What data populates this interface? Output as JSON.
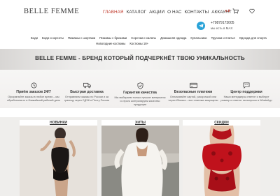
{
  "header": {
    "logo": "BELLE FEMME",
    "nav": [
      "ГЛАВНАЯ",
      "КАТАЛОГ",
      "АКЦИИ",
      "О НАС",
      "КОНТАКТЫ",
      "АККАУНТ"
    ],
    "active_nav": "ГЛАВНАЯ",
    "cart_count": "0 ₽",
    "phone": "+79879173005",
    "messenger": "мы есть в MAX"
  },
  "categories": {
    "row1": [
      "Боди",
      "Боди и корсеты",
      "Пижамы с шортами",
      "Пижамы с брюками",
      "Сорочки и халаты",
      "Домашняя одежда",
      "Купальники",
      "Трусики и платья",
      "Одежда для спорта"
    ],
    "row2": [
      "Новогодние костюмы",
      "Костюмы 18+"
    ]
  },
  "hero": {
    "title": "BELLE FEMME - БРЕНД КОТОРЫЙ ПОДЧЕРКНЁТ ТВОЮ УНИКАЛЬНОСТЬ"
  },
  "features": [
    {
      "icon": "clock-icon",
      "title": "Приём заказов 24/7",
      "desc": "Оформляйте заказы в любое время – мы обработаем их в ближайший рабочий день"
    },
    {
      "icon": "truck-icon",
      "title": "Быстрая доставка",
      "desc": "Отправляем заказы по России и за границу через СДЭК и Почту России"
    },
    {
      "icon": "shield-icon",
      "title": "Гарантия качества",
      "desc": "Мы выбираем только лучшие материалы и строго контролируем качество продукции"
    },
    {
      "icon": "card-icon",
      "title": "Безопасные платежи",
      "desc": "Оплачивайте картой, рассрочкой или через Юkassa – все платежи защищены"
    },
    {
      "icon": "chat-icon",
      "title": "Центр поддержки",
      "desc": "Наши менеджеры ответят и выберут размер и ответят на вопросы в WhatsApp"
    }
  ],
  "products": [
    {
      "label": "НОВИНКИ"
    },
    {
      "label": "ХИТЫ"
    },
    {
      "label": "СКИДКИ"
    }
  ],
  "colors": {
    "accent": "#c0392b",
    "telegram": "#2aa3d8"
  }
}
